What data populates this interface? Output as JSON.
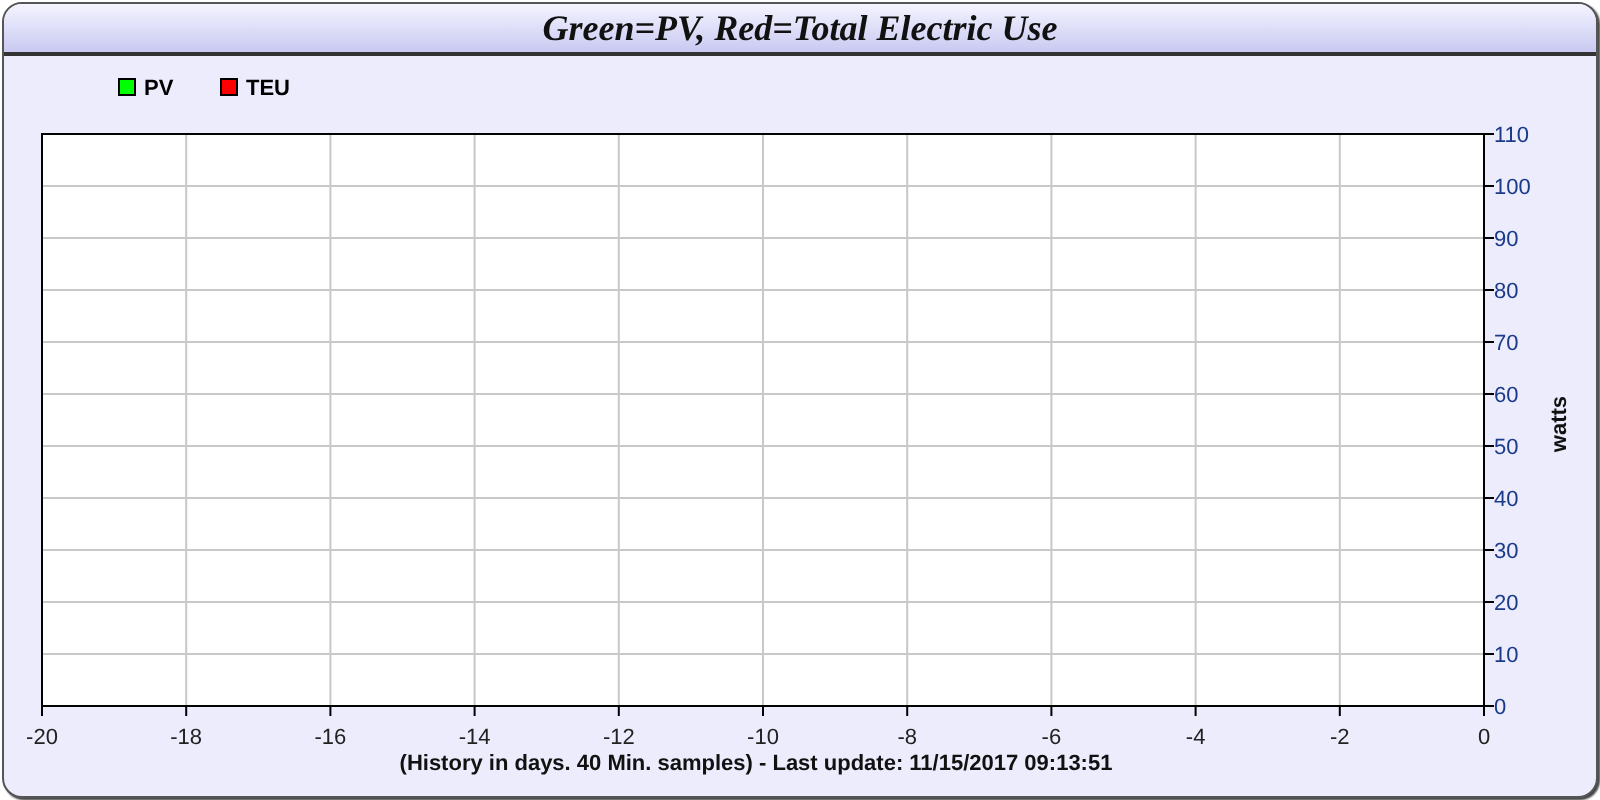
{
  "title": "Green=PV, Red=Total Electric Use",
  "chart_data": {
    "type": "line",
    "ylabel": "watts",
    "xlabel": "(History in days. 40 Min. samples) - Last update: 11/15/2017 09:13:51",
    "series": [
      {
        "name": "PV",
        "color": "#00ff00",
        "values": [
          null,
          null,
          null,
          null,
          null,
          null,
          null,
          null,
          null,
          null,
          null
        ]
      },
      {
        "name": "TEU",
        "color": "#ff0000",
        "values": [
          null,
          null,
          null,
          null,
          null,
          null,
          null,
          null,
          null,
          null,
          null
        ]
      }
    ],
    "categories": [
      "-20",
      "-18",
      "-16",
      "-14",
      "-12",
      "-10",
      "-8",
      "-6",
      "-4",
      "-2",
      "0"
    ],
    "ylim": [
      0,
      110
    ],
    "grid": true,
    "yticks": [
      0,
      10,
      20,
      30,
      40,
      50,
      60,
      70,
      80,
      90,
      100,
      110
    ]
  }
}
